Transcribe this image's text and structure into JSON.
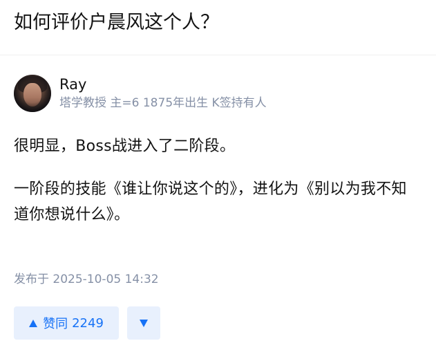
{
  "question": {
    "title": "如何评价户晨风这个人？"
  },
  "answer": {
    "author": {
      "name": "Ray",
      "bio": "塔学教授 主=6 1875年出生 K签持有人",
      "avatar": "avatar-portrait"
    },
    "paragraphs": [
      "很明显，Boss战进入了二阶段。",
      "一阶段的技能《谁让你说这个的》，进化为《别以为我不知道你想说什么》。"
    ],
    "publish_time": "发布于 2025-10-05 14:32",
    "vote_up": {
      "label": "赞同",
      "count": "2249",
      "icon": "triangle-up-icon"
    },
    "vote_down": {
      "icon": "triangle-down-icon"
    }
  },
  "colors": {
    "accent": "#1772f6",
    "accent_bg": "#e8f0fd",
    "meta_text": "#8590a6",
    "body_text": "#121212"
  }
}
